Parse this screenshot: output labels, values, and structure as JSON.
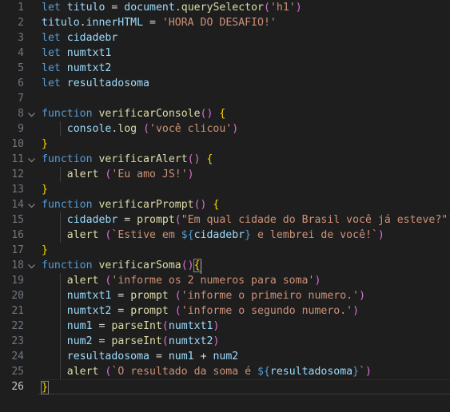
{
  "editor": {
    "name": "code-editor",
    "language": "javascript",
    "theme": "dark-plus",
    "background": "#1e1e1e",
    "line_number_color": "#6e7681",
    "active_line_number_color": "#c6c6c6",
    "total_lines": 26,
    "active_line": 26,
    "colors": {
      "keyword": "#569cd6",
      "variable": "#9cdcfe",
      "function": "#dcdcaa",
      "string": "#ce9178",
      "operator": "#d4d4d4",
      "paren_magenta": "#da70d6",
      "paren_blue": "#179fff",
      "brace_yellow": "#ffd700",
      "number": "#b5cea8"
    },
    "fold_icon": "chevron-down-icon"
  },
  "lines": [
    {
      "n": "1",
      "fold": false,
      "guide": false,
      "text": "let titulo = document.querySelector('h1')"
    },
    {
      "n": "2",
      "fold": false,
      "guide": false,
      "text": "titulo.innerHTML = 'HORA DO DESAFIO!'"
    },
    {
      "n": "3",
      "fold": false,
      "guide": false,
      "text": "let cidadebr"
    },
    {
      "n": "4",
      "fold": false,
      "guide": false,
      "text": "let numtxt1"
    },
    {
      "n": "5",
      "fold": false,
      "guide": false,
      "text": "let numtxt2"
    },
    {
      "n": "6",
      "fold": false,
      "guide": false,
      "text": "let resultadosoma"
    },
    {
      "n": "7",
      "fold": false,
      "guide": false,
      "text": ""
    },
    {
      "n": "8",
      "fold": true,
      "guide": false,
      "text": "function verificarConsole() {"
    },
    {
      "n": "9",
      "fold": false,
      "guide": true,
      "text": "    console.log ('você clicou')"
    },
    {
      "n": "10",
      "fold": false,
      "guide": false,
      "text": "}"
    },
    {
      "n": "11",
      "fold": true,
      "guide": false,
      "text": "function verificarAlert() {"
    },
    {
      "n": "12",
      "fold": false,
      "guide": true,
      "text": "    alert ('Eu amo JS!')"
    },
    {
      "n": "13",
      "fold": false,
      "guide": false,
      "text": "}"
    },
    {
      "n": "14",
      "fold": true,
      "guide": false,
      "text": "function verificarPrompt() {"
    },
    {
      "n": "15",
      "fold": false,
      "guide": true,
      "text": "    cidadebr = prompt(\"Em qual cidade do Brasil você já esteve?\")"
    },
    {
      "n": "16",
      "fold": false,
      "guide": true,
      "text": "    alert (`Estive em ${cidadebr} e lembrei de você!`)"
    },
    {
      "n": "17",
      "fold": false,
      "guide": false,
      "text": "}"
    },
    {
      "n": "18",
      "fold": true,
      "guide": false,
      "text": "function verificarSoma(){"
    },
    {
      "n": "19",
      "fold": false,
      "guide": true,
      "text": "    alert ('informe os 2 numeros para soma')"
    },
    {
      "n": "20",
      "fold": false,
      "guide": true,
      "text": "    numtxt1 = prompt ('informe o primeiro numero.')"
    },
    {
      "n": "21",
      "fold": false,
      "guide": true,
      "text": "    numtxt2 = prompt ('informe o segundo numero.')"
    },
    {
      "n": "22",
      "fold": false,
      "guide": true,
      "text": "    num1 = parseInt(numtxt1)"
    },
    {
      "n": "23",
      "fold": false,
      "guide": true,
      "text": "    num2 = parseInt(numtxt2)"
    },
    {
      "n": "24",
      "fold": false,
      "guide": true,
      "text": "    resultadosoma = num1 + num2"
    },
    {
      "n": "25",
      "fold": false,
      "guide": true,
      "text": "    alert (`O resultado da soma é ${resultadosoma}`)"
    },
    {
      "n": "26",
      "fold": false,
      "guide": false,
      "text": "}"
    }
  ]
}
